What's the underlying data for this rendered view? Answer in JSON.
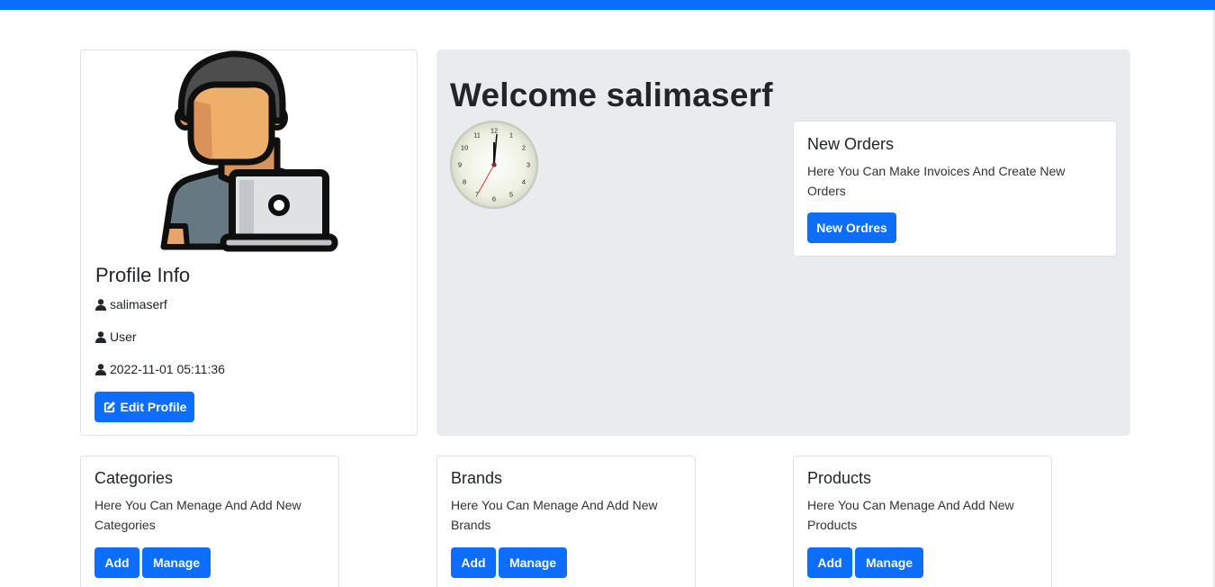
{
  "profile": {
    "title": "Profile Info",
    "username": "salimaserf",
    "role": "User",
    "created": "2022-11-01 05:11:36",
    "edit_label": "Edit Profile"
  },
  "welcome": {
    "heading": "Welcome salimaserf",
    "clock_numbers": [
      "12",
      "1",
      "2",
      "3",
      "4",
      "5",
      "6",
      "7",
      "8",
      "9",
      "10",
      "11"
    ]
  },
  "orders": {
    "title": "New Orders",
    "text": "Here You Can Make Invoices And Create New Orders",
    "button": "New Ordres"
  },
  "categories": {
    "title": "Categories",
    "text": "Here You Can Menage And Add New Categories",
    "add": "Add",
    "manage": "Manage"
  },
  "brands": {
    "title": "Brands",
    "text": "Here You Can Menage And Add New Brands",
    "add": "Add",
    "manage": "Manage"
  },
  "products": {
    "title": "Products",
    "text": "Here You Can Menage And Add New Products",
    "add": "Add",
    "manage": "Manage"
  },
  "colors": {
    "primary": "#0d6efd",
    "jumbotron": "#e9ecef"
  },
  "icons": {
    "info_rows": "user-icon",
    "edit": "edit-icon"
  }
}
